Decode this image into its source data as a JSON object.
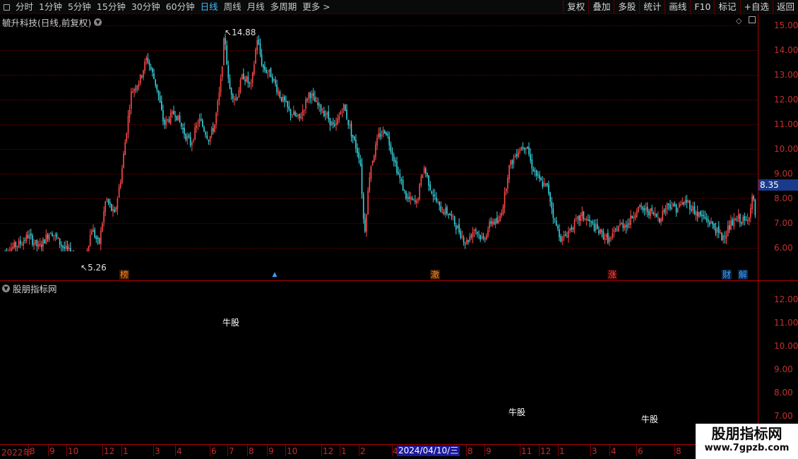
{
  "toolbar": {
    "periods": [
      "分时",
      "1分钟",
      "5分钟",
      "15分钟",
      "30分钟",
      "60分钟",
      "日线",
      "周线",
      "月线",
      "多周期",
      "更多 >"
    ],
    "active_period": "日线",
    "tools": [
      "复权",
      "叠加",
      "多股",
      "统计",
      "画线",
      "F10",
      "标记",
      "+自选",
      "返回"
    ]
  },
  "chart": {
    "title": "毓升科技(日线,前复权)",
    "price_axis": [
      "15.00",
      "14.00",
      "13.00",
      "12.00",
      "11.00",
      "10.00",
      "9.00",
      "8.00",
      "7.00",
      "6.00"
    ],
    "current_price": "8.35",
    "high_label": "14.88",
    "low_label": "5.26",
    "events": [
      {
        "text": "榜",
        "color": "#ff8a2a"
      },
      {
        "text": "▲",
        "color": "#3aa0ff"
      },
      {
        "text": "澈",
        "color": "#ff8a2a"
      },
      {
        "text": "涨",
        "color": "#ff5050"
      },
      {
        "text": "财",
        "color": "#3aa0ff"
      },
      {
        "text": "解",
        "color": "#3aa0ff"
      }
    ],
    "colors": {
      "up": "#ff4a4a",
      "down": "#36d4e0",
      "axis": "#b00000"
    }
  },
  "indicator": {
    "title": "股朋指标网",
    "axis": [
      "12.00",
      "11.00",
      "10.00",
      "9.00",
      "8.00",
      "7.00"
    ],
    "signals": [
      "牛股",
      "牛股",
      "牛股"
    ]
  },
  "date_axis": {
    "labels": [
      "2022年",
      "8",
      "9",
      "10",
      "12",
      "1",
      "3",
      "4",
      "6",
      "7",
      "8",
      "9",
      "10",
      "12",
      "1",
      "2",
      "4",
      "8",
      "9",
      "11",
      "12",
      "1",
      "3",
      "4",
      "6",
      "8"
    ],
    "cursor_date": "2024/04/10/三"
  },
  "watermark": {
    "title": "股朋指标网",
    "url": "www.7gpzb.com"
  }
}
